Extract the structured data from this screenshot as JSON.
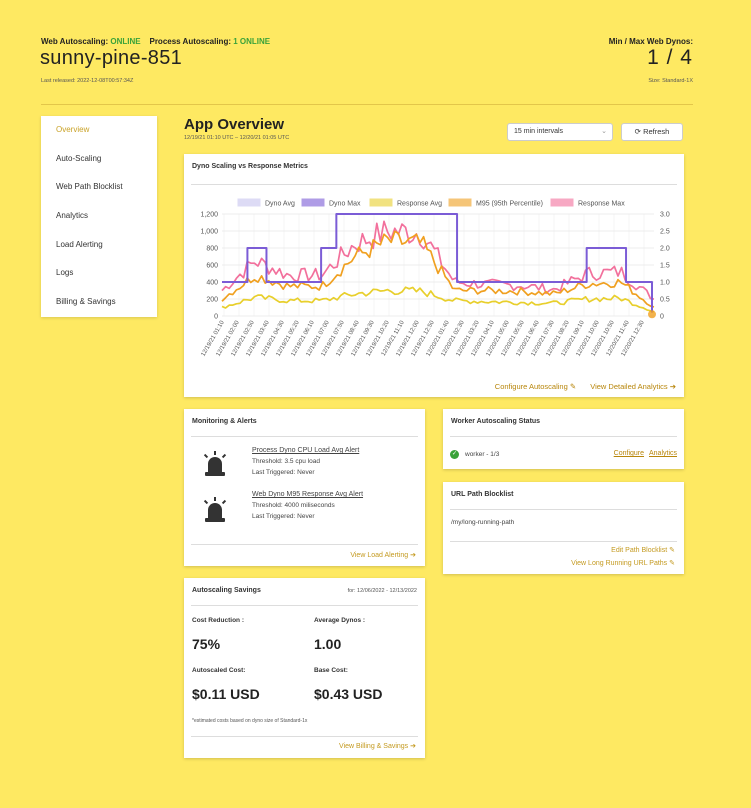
{
  "header": {
    "web_autoscaling_label": "Web Autoscaling:",
    "web_autoscaling_status": "ONLINE",
    "process_autoscaling_label": "Process Autoscaling:",
    "process_autoscaling_status": "1 ONLINE",
    "app_name": "sunny-pine-851",
    "last_released": "Last released: 2022-12-08T00:57:34Z",
    "dynos_label": "Min / Max Web Dynos:",
    "dynos_value": "1 / 4",
    "size": "Size: Standard-1X"
  },
  "sidebar": {
    "items": [
      {
        "label": "Overview"
      },
      {
        "label": "Auto-Scaling"
      },
      {
        "label": "Web Path Blocklist"
      },
      {
        "label": "Analytics"
      },
      {
        "label": "Load Alerting"
      },
      {
        "label": "Logs"
      },
      {
        "label": "Billing & Savings"
      }
    ]
  },
  "main": {
    "title": "App Overview",
    "range": "12/19/21 01:10 UTC  –  12/20/21 01:05 UTC",
    "interval": "15 min intervals",
    "refresh": "Refresh"
  },
  "chart_card": {
    "title": "Dyno Scaling vs Response Metrics",
    "configure_link": "Configure Autoscaling",
    "analytics_link": "View Detailed Analytics"
  },
  "chart_data": {
    "type": "line",
    "legend": [
      "Dyno Avg",
      "Dyno Max",
      "Response Avg",
      "M95 (95th Percentile)",
      "Response Max"
    ],
    "legend_placement": "top",
    "colors": {
      "dyno_avg": "#c8c4f0",
      "dyno_max": "#7b5cd6",
      "response_avg": "#e8cf2c",
      "m95": "#f0a020",
      "response_max": "#f2709c"
    },
    "y_left_ticks": [
      "0",
      "200",
      "400",
      "600",
      "800",
      "1,000",
      "1,200"
    ],
    "y_left_range": [
      0,
      1200
    ],
    "y_right_ticks": [
      "0",
      "0.5",
      "1.0",
      "1.5",
      "2.0",
      "2.5",
      "3.0"
    ],
    "y_right_range": [
      0,
      3
    ],
    "x_labels": [
      "12/19/21 01:10",
      "12/19/21 02:00",
      "12/19/21 02:50",
      "12/19/21 03:40",
      "12/19/21 04:30",
      "12/19/21 05:20",
      "12/19/21 06:10",
      "12/19/21 07:00",
      "12/19/21 07:50",
      "12/19/21 08:40",
      "12/19/21 09:30",
      "12/19/21 10:20",
      "12/19/21 11:10",
      "12/19/21 12:00",
      "12/19/21 12:50",
      "12/20/21 01:40",
      "12/20/21 02:30",
      "12/20/21 03:20",
      "12/20/21 04:10",
      "12/20/21 05:00",
      "12/20/21 05:50",
      "12/20/21 06:40",
      "12/20/21 07:30",
      "12/20/21 08:20",
      "12/20/21 09:10",
      "12/20/21 10:00",
      "12/20/21 10:50",
      "12/20/21 11:40",
      "12/20/21 12:30"
    ],
    "dyno_max_steps": [
      {
        "x": 0,
        "y": 1
      },
      {
        "x": 1,
        "y": 1
      },
      {
        "x": 2,
        "y": 2
      },
      {
        "x": 3,
        "y": 2
      },
      {
        "x": 3.5,
        "y": 1
      },
      {
        "x": 7.5,
        "y": 1
      },
      {
        "x": 7.8,
        "y": 2
      },
      {
        "x": 9,
        "y": 3
      },
      {
        "x": 18,
        "y": 3
      },
      {
        "x": 18.5,
        "y": 1
      },
      {
        "x": 28.5,
        "y": 1
      },
      {
        "x": 28.7,
        "y": 2
      },
      {
        "x": 31.5,
        "y": 2
      },
      {
        "x": 31.8,
        "y": 1
      }
    ],
    "series_approx": {
      "response_max_levels": [
        300,
        650,
        480,
        480,
        850,
        1000,
        980,
        400,
        370,
        360,
        310,
        500,
        520,
        200
      ],
      "m95_levels": [
        200,
        480,
        350,
        350,
        700,
        880,
        850,
        300,
        300,
        290,
        260,
        380,
        400,
        100
      ],
      "response_avg_levels": [
        100,
        220,
        180,
        180,
        260,
        300,
        290,
        180,
        170,
        160,
        150,
        200,
        210,
        50
      ]
    }
  },
  "monitoring": {
    "title": "Monitoring & Alerts",
    "alerts": [
      {
        "name": "Process Dyno CPU Load Avg Alert",
        "threshold": "Threshold:  3.5 cpu load",
        "triggered": "Last Triggered:  Never"
      },
      {
        "name": "Web Dyno M95 Response Avg Alert",
        "threshold": "Threshold:  4000 miliseconds",
        "triggered": "Last Triggered:  Never"
      }
    ],
    "link": "View Load Alerting"
  },
  "worker": {
    "title": "Worker Autoscaling Status",
    "name": "worker - 1/3",
    "configure": "Configure",
    "analytics": "Analytics"
  },
  "url_blocklist": {
    "title": "URL Path Blocklist",
    "path": "/my/long-running-path",
    "edit_link": "Edit Path Blocklist",
    "view_link": "View Long Running URL Paths"
  },
  "savings": {
    "title": "Autoscaling Savings",
    "range": "for: 12/06/2022 - 12/13/2022",
    "cost_reduction_label": "Cost Reduction :",
    "cost_reduction": "75%",
    "avg_dynos_label": "Average Dynos :",
    "avg_dynos": "1.00",
    "autoscaled_label": "Autoscaled Cost:",
    "autoscaled": "$0.11 USD",
    "base_label": "Base Cost:",
    "base": "$0.43 USD",
    "note": "*estimated costs based on dyno size of Standard-1x",
    "link": "View Billing & Savings"
  }
}
